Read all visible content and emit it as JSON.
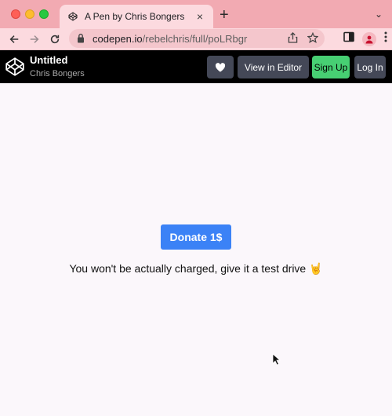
{
  "browser": {
    "tab": {
      "title": "A Pen by Chris Bongers",
      "close": "×"
    },
    "new_tab": "+",
    "tab_menu": "⌄",
    "address": {
      "host": "codepen.io",
      "path": "/rebelchris/full/poLRbgr"
    }
  },
  "codepen": {
    "title": "Untitled",
    "author": "Chris Bongers",
    "buttons": {
      "view_in_editor": "View in Editor",
      "sign_up": "Sign Up",
      "log_in": "Log In"
    }
  },
  "main": {
    "donate_label": "Donate 1$",
    "note": "You won't be actually charged, give it a test drive 🤘"
  },
  "colors": {
    "tabbar": "#f2aab2",
    "toolbar": "#fcdadf",
    "donate": "#3b82f6",
    "signup": "#47cf73",
    "header_btn": "#444857"
  }
}
